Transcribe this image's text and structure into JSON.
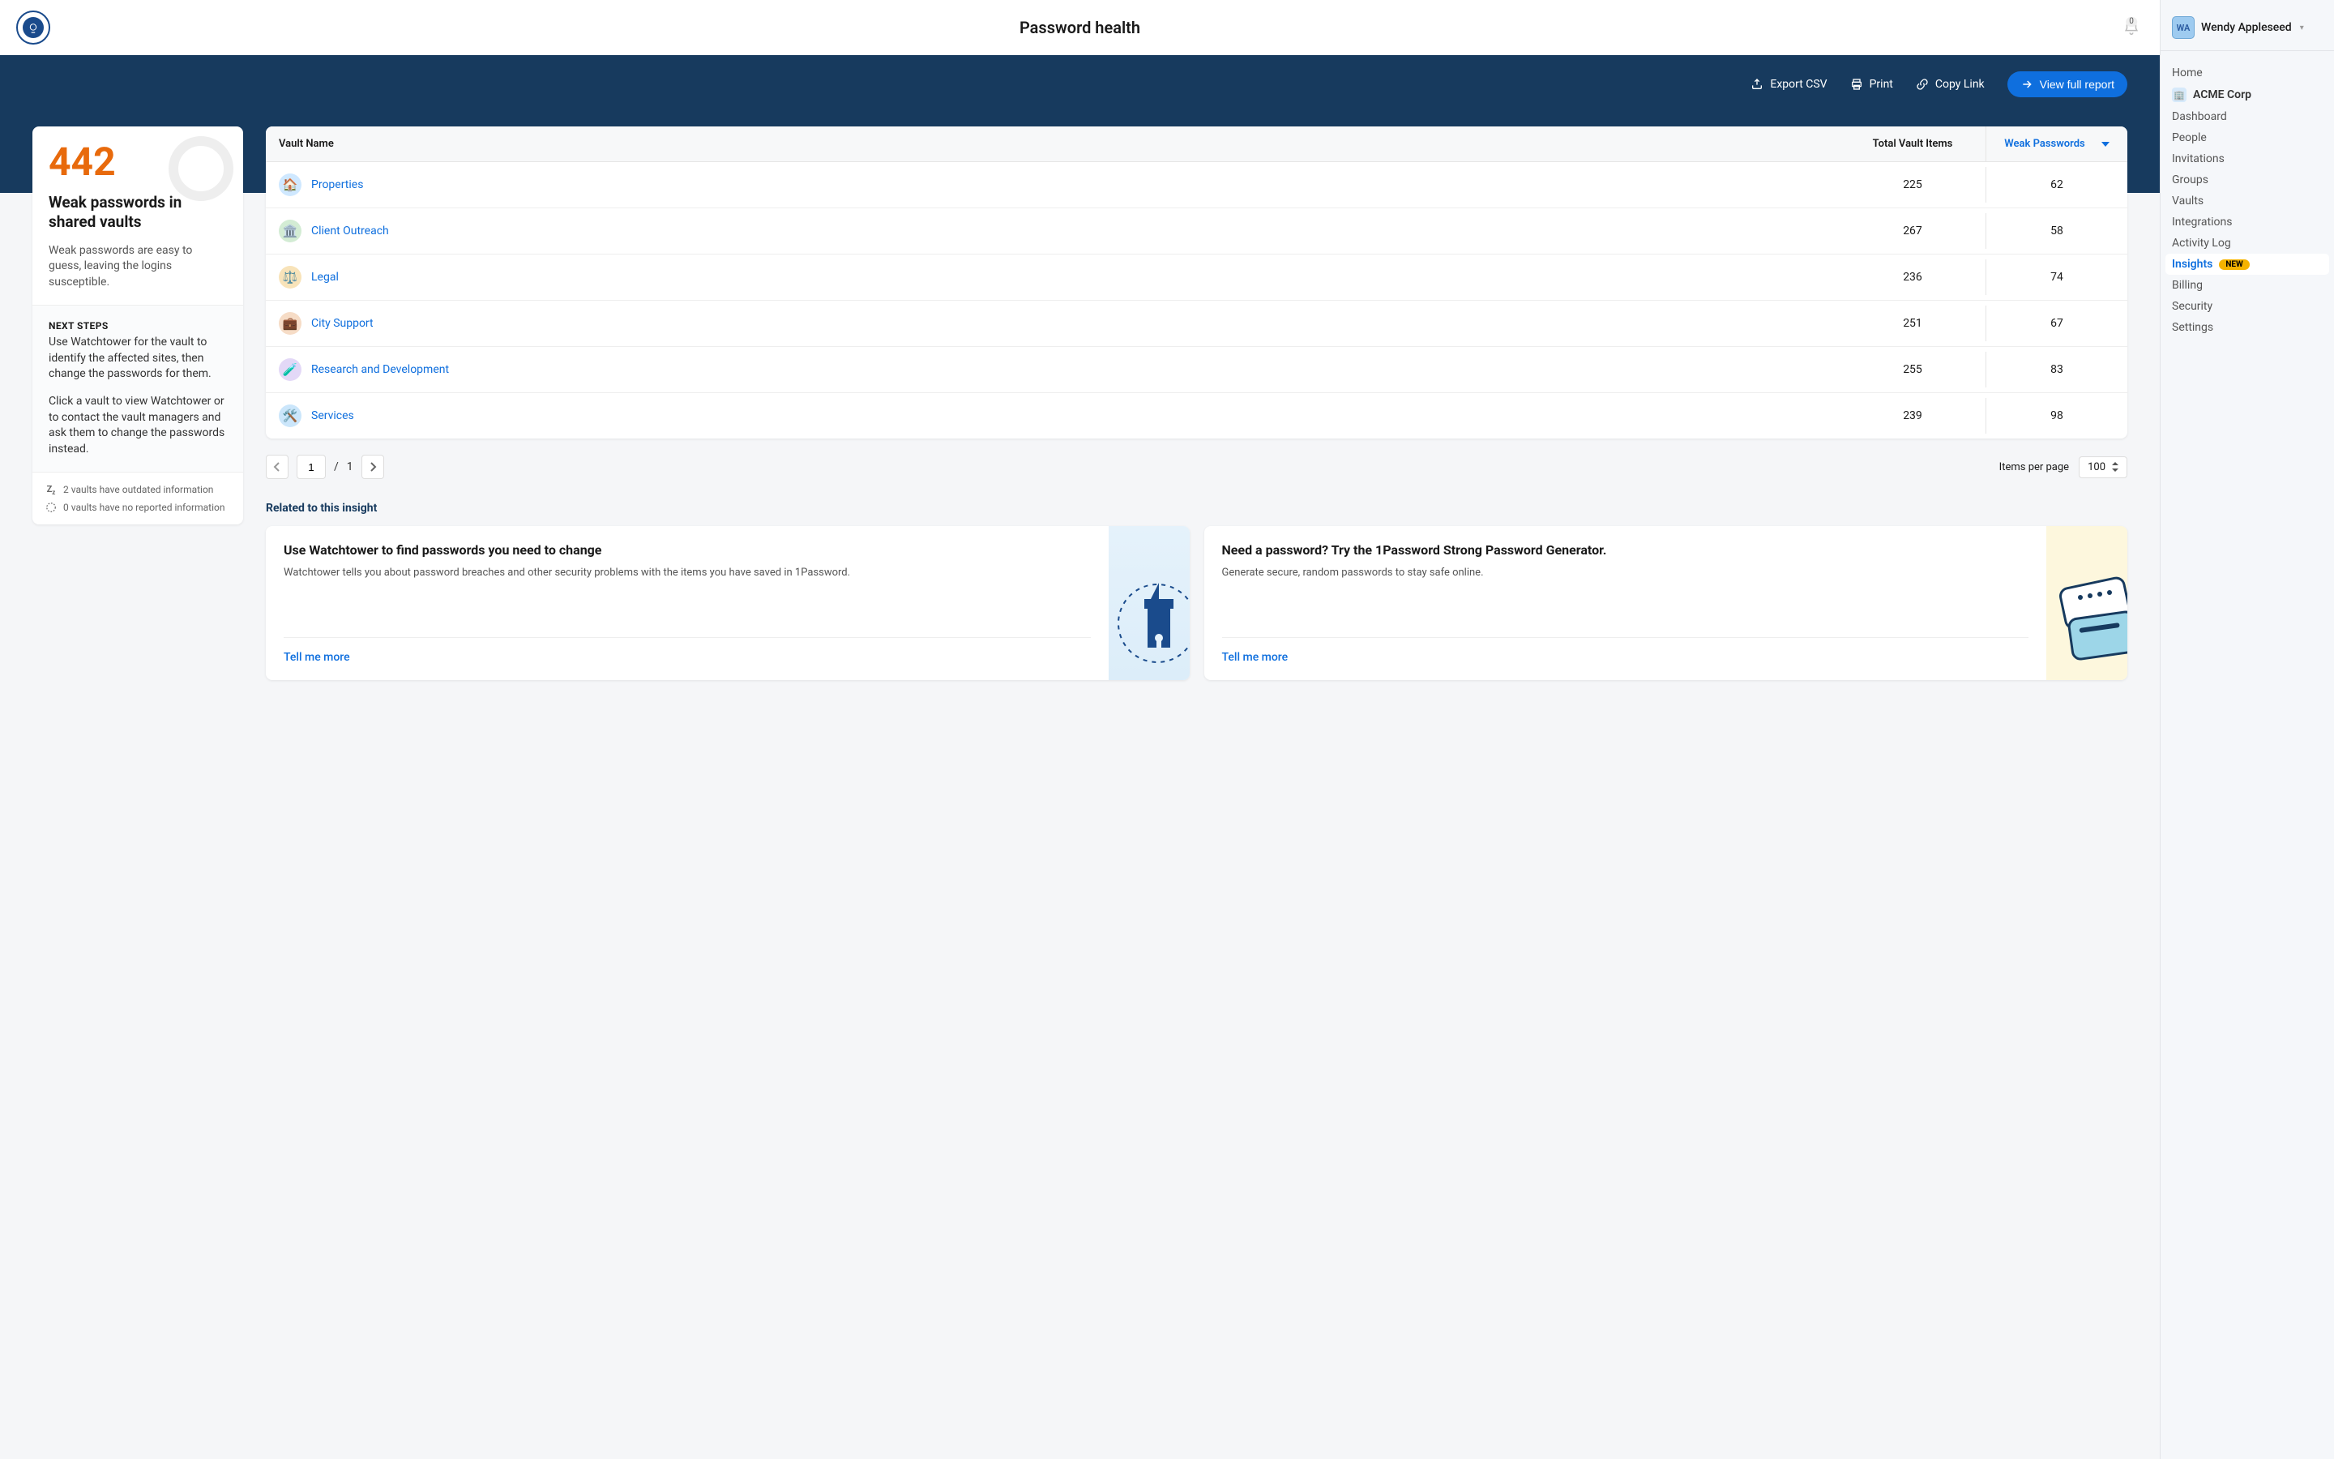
{
  "header": {
    "title": "Password health",
    "notification_count": "0"
  },
  "actions": {
    "export_csv": "Export CSV",
    "print": "Print",
    "copy_link": "Copy Link",
    "view_full_report": "View full report"
  },
  "summary": {
    "count": "442",
    "heading": "Weak passwords in shared vaults",
    "body": "Weak passwords are easy to guess, leaving the logins susceptible.",
    "next_steps_label": "NEXT STEPS",
    "next_steps_1": "Use Watchtower for the vault to identify the affected sites, then change the passwords for them.",
    "next_steps_2": "Click a vault to view Watchtower or to contact the vault managers and ask them to change the passwords instead.",
    "footer_outdated": "2 vaults have outdated information",
    "footer_noreport": "0 vaults have no reported information"
  },
  "table": {
    "col_name": "Vault Name",
    "col_total": "Total Vault Items",
    "col_weak": "Weak Passwords",
    "rows": [
      {
        "name": "Properties",
        "total": "225",
        "weak": "62",
        "icon": "🏠",
        "bg": "#cfe8ff"
      },
      {
        "name": "Client Outreach",
        "total": "267",
        "weak": "58",
        "icon": "🏛️",
        "bg": "#d3ecd4"
      },
      {
        "name": "Legal",
        "total": "236",
        "weak": "74",
        "icon": "⚖️",
        "bg": "#f8e3b9"
      },
      {
        "name": "City Support",
        "total": "251",
        "weak": "67",
        "icon": "💼",
        "bg": "#f6dcc6"
      },
      {
        "name": "Research and Development",
        "total": "255",
        "weak": "83",
        "icon": "🧪",
        "bg": "#e3d8f7"
      },
      {
        "name": "Services",
        "total": "239",
        "weak": "98",
        "icon": "🛠️",
        "bg": "#cbe6fb"
      }
    ]
  },
  "pagination": {
    "current": "1",
    "total": "1",
    "items_per_page_label": "Items per page",
    "items_per_page": "100"
  },
  "related": {
    "heading": "Related to this insight",
    "cards": [
      {
        "title": "Use Watchtower to find passwords you need to change",
        "body": "Watchtower tells you about password breaches and other security problems with the items you have saved in 1Password.",
        "cta": "Tell me more"
      },
      {
        "title": "Need a password? Try the 1Password Strong Password Generator.",
        "body": "Generate secure, random passwords to stay safe online.",
        "cta": "Tell me more"
      }
    ]
  },
  "sidebar": {
    "user_initials": "WA",
    "user_name": "Wendy Appleseed",
    "home": "Home",
    "org_name": "ACME Corp",
    "items": {
      "dashboard": "Dashboard",
      "people": "People",
      "invitations": "Invitations",
      "groups": "Groups",
      "vaults": "Vaults",
      "integrations": "Integrations",
      "activity_log": "Activity Log",
      "insights": "Insights",
      "billing": "Billing",
      "security": "Security",
      "settings": "Settings"
    },
    "new_badge": "NEW"
  }
}
